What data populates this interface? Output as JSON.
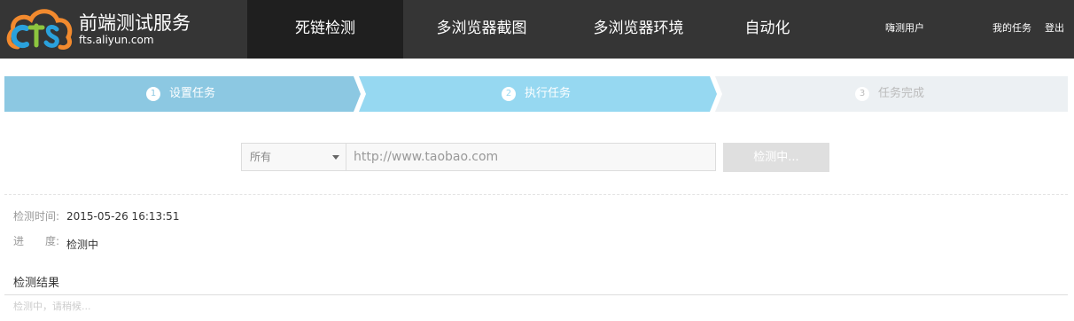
{
  "brand": {
    "name": "前端测试服务",
    "url": "fts.aliyun.com",
    "logo_letters": [
      "F",
      "T",
      "S"
    ]
  },
  "nav": {
    "items": [
      {
        "label": "死链检测",
        "active": true
      },
      {
        "label": "多浏览器截图",
        "active": false
      },
      {
        "label": "多浏览器环境",
        "active": false
      },
      {
        "label": "自动化",
        "active": false
      }
    ]
  },
  "user": {
    "name": "嗨测用户",
    "my_tasks": "我的任务",
    "logout": "登出"
  },
  "steps": [
    {
      "num": "1",
      "label": "设置任务",
      "state": "done"
    },
    {
      "num": "2",
      "label": "执行任务",
      "state": "current"
    },
    {
      "num": "3",
      "label": "任务完成",
      "state": "todo"
    }
  ],
  "form": {
    "select_value": "所有",
    "url_placeholder": "http://www.taobao.com",
    "url_value": "",
    "submit_label": "检测中..."
  },
  "info": {
    "time_label": "检测时间:",
    "time_value": "2015-05-26 16:13:51",
    "progress_label_1": "进",
    "progress_label_2": "度:",
    "progress_value": "检测中"
  },
  "results": {
    "title": "检测结果",
    "message": "检测中，请稍候..."
  },
  "colors": {
    "topbar": "#353535",
    "nav_active": "#1f1f1f",
    "step_done": "#8cc8e2",
    "step_current": "#96d8f1",
    "step_todo": "#ecf0f3",
    "button_disabled": "#dfdfdf"
  }
}
